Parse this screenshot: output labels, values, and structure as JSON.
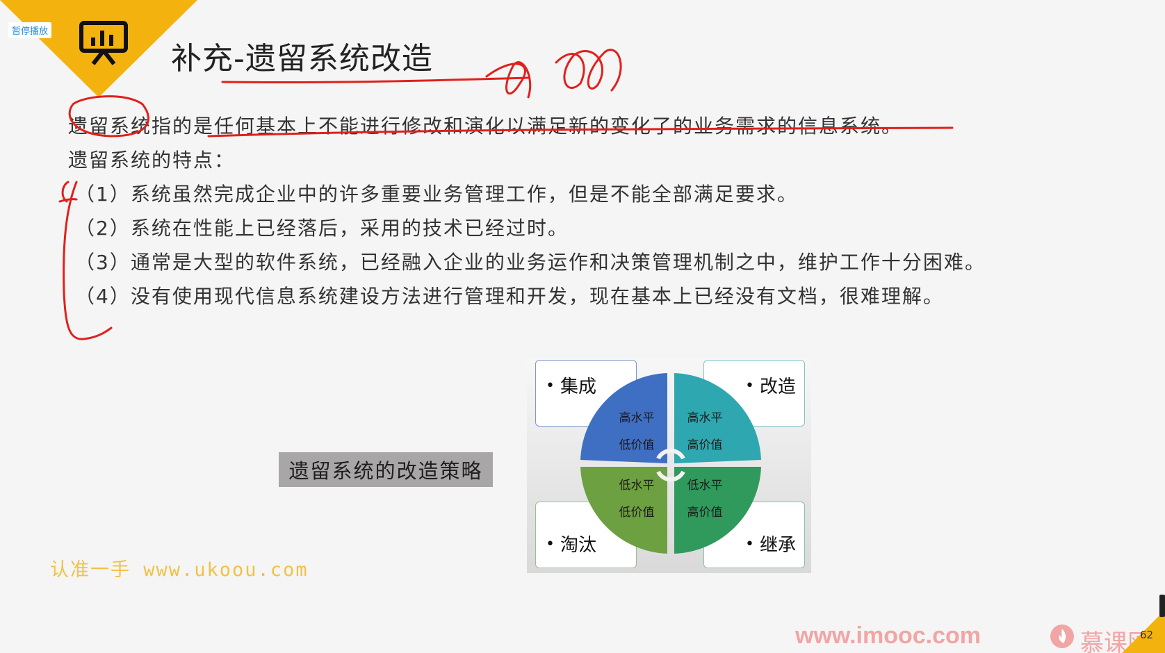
{
  "player": {
    "pause_label": "暂停播放"
  },
  "slide": {
    "title": "补充-遗留系统改造",
    "definition": "遗留系统指的是任何基本上不能进行修改和演化以满足新的变化了的业务需求的信息系统。",
    "features_heading": "遗留系统的特点：",
    "features": [
      "（1）系统虽然完成企业中的许多重要业务管理工作，但是不能全部满足要求。",
      "（2）系统在性能上已经落后，采用的技术已经过时。",
      "（3）通常是大型的软件系统，已经融入企业的业务运作和决策管理机制之中，维护工作十分困难。",
      "（4）没有使用现代信息系统建设方法进行管理和开发，现在基本上已经没有文档，很难理解。"
    ],
    "strategy_label": "遗留系统的改造策略",
    "matrix": {
      "top_left": {
        "label": "集成",
        "line1": "高水平",
        "line2": "低价值"
      },
      "top_right": {
        "label": "改造",
        "line1": "高水平",
        "line2": "高价值"
      },
      "bottom_left": {
        "label": "淘汰",
        "line1": "低水平",
        "line2": "低价值"
      },
      "bottom_right": {
        "label": "继承",
        "line1": "低水平",
        "line2": "高价值"
      },
      "bullet": "•",
      "colors": {
        "top_left": "#3f6fc3",
        "top_right": "#2fa7b0",
        "bottom_left": "#6da040",
        "bottom_right": "#2f9a5c"
      }
    },
    "watermark": "认准一手 www.ukoou.com",
    "page_number": "62"
  },
  "footer": {
    "site": "www.imooc.com",
    "brand": "慕课网"
  },
  "colors": {
    "accent": "#f3b20e",
    "annotation": "#e0201b"
  }
}
